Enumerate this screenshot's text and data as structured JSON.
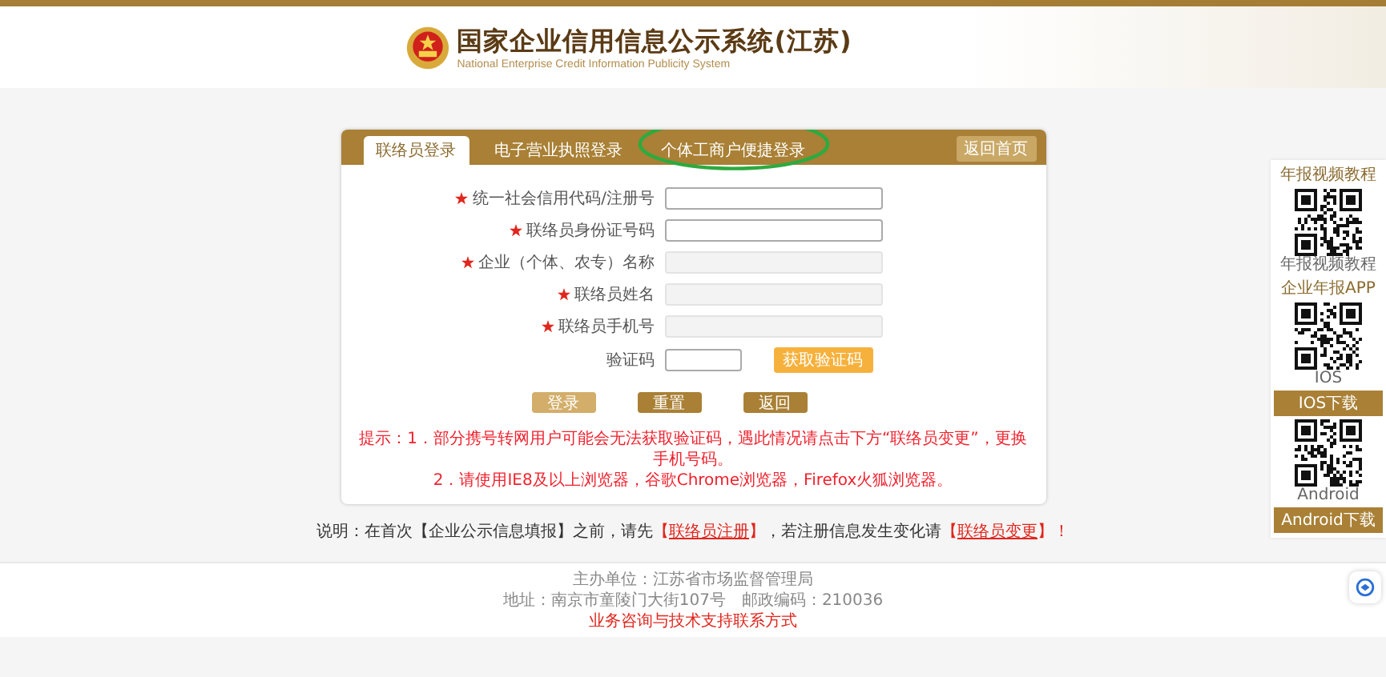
{
  "header": {
    "title": "国家企业信用信息公示系统(江苏)",
    "subtitle": "National Enterprise Credit Information Publicity System"
  },
  "login_card": {
    "tabs": [
      {
        "label": "联络员登录",
        "selected": true,
        "circled": false
      },
      {
        "label": "电子营业执照登录",
        "selected": false,
        "circled": false
      },
      {
        "label": "个体工商户便捷登录",
        "selected": false,
        "circled": true
      }
    ],
    "home_button": "返回首页",
    "fields": [
      {
        "label": "统一社会信用代码/注册号",
        "required": true,
        "disabled": false
      },
      {
        "label": "联络员身份证号码",
        "required": true,
        "disabled": false
      },
      {
        "label": "企业（个体、农专）名称",
        "required": true,
        "disabled": true
      },
      {
        "label": "联络员姓名",
        "required": true,
        "disabled": true
      },
      {
        "label": "联络员手机号",
        "required": true,
        "disabled": true
      }
    ],
    "captcha": {
      "label": "验证码",
      "button": "获取验证码"
    },
    "buttons": [
      {
        "label": "登录",
        "disabled": true
      },
      {
        "label": "重置",
        "disabled": false
      },
      {
        "label": "返回",
        "disabled": false
      }
    ],
    "tips": [
      "提示：1．部分携号转网用户可能会无法获取验证码，遇此情况请点击下方“联络员变更”，更换手机号码。",
      "2．请使用IE8及以上浏览器，谷歌Chrome浏览器，Firefox火狐浏览器。"
    ]
  },
  "note": [
    {
      "kind": "text",
      "text": "说明：在首次【企业公示信息填报】之前，请先"
    },
    {
      "kind": "red",
      "text": "【"
    },
    {
      "kind": "link",
      "text": "联络员注册"
    },
    {
      "kind": "red",
      "text": "】"
    },
    {
      "kind": "text",
      "text": "，若注册信息发生变化请"
    },
    {
      "kind": "red",
      "text": "【"
    },
    {
      "kind": "link",
      "text": "联络员变更"
    },
    {
      "kind": "red",
      "text": "】！"
    }
  ],
  "footer": [
    {
      "kind": "text",
      "text": "主办单位：江苏省市场监督管理局"
    },
    {
      "kind": "text",
      "text": "地址：南京市童陵门大街107号　邮政编码：210036"
    },
    {
      "kind": "link",
      "text": "业务咨询与技术支持联系方式"
    }
  ],
  "sidebar": [
    {
      "kind": "title",
      "text": "年报视频教程"
    },
    {
      "kind": "qr",
      "text": "年报视频教程"
    },
    {
      "kind": "title",
      "text": "企业年报APP"
    },
    {
      "kind": "qr",
      "text": "IOS"
    },
    {
      "kind": "button",
      "text": "IOS下载"
    },
    {
      "kind": "qr",
      "text": "Android"
    },
    {
      "kind": "button",
      "text": "Android下载"
    }
  ]
}
